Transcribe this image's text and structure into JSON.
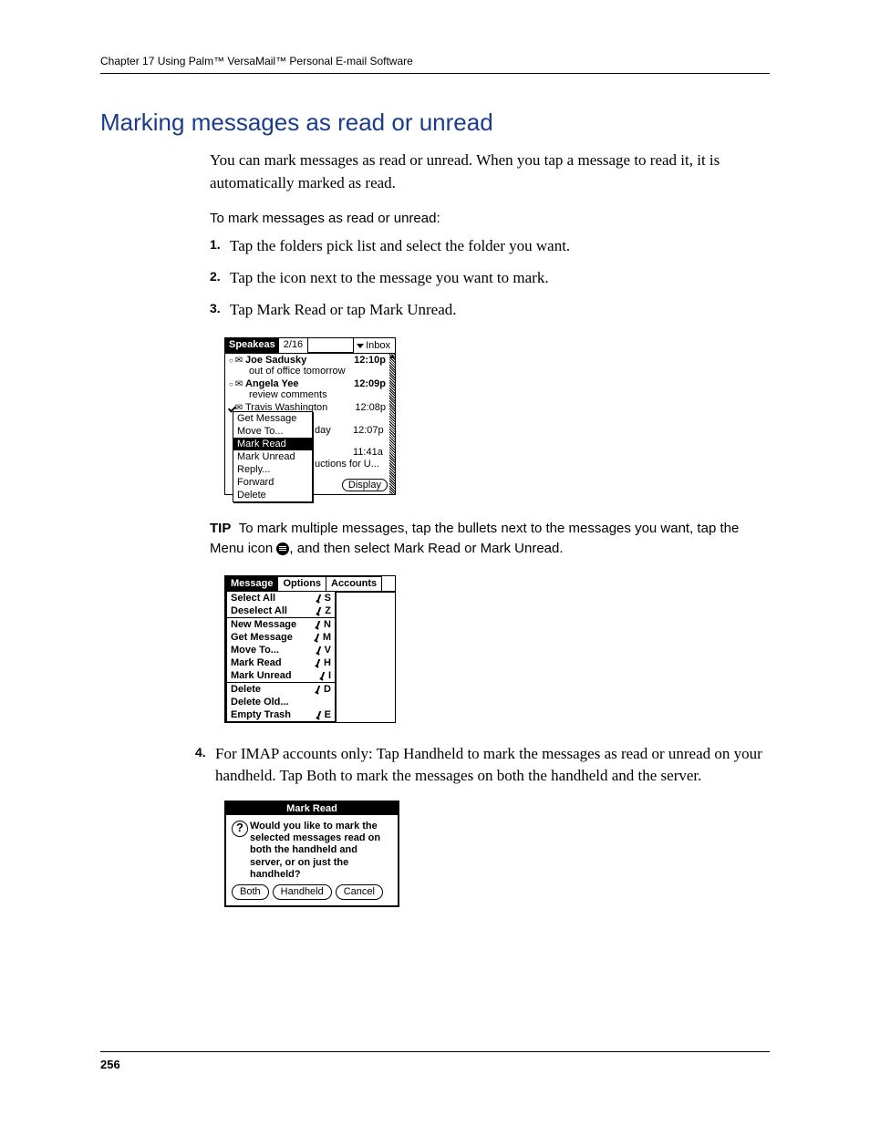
{
  "header": {
    "running": "Chapter 17    Using Palm™ VersaMail™ Personal E-mail Software"
  },
  "section": {
    "title": "Marking messages as read or unread",
    "intro": "You can mark messages as read or unread. When you tap a message to read it, it is automatically marked as read.",
    "procedure_head": "To mark messages as read or unread:",
    "step1": "Tap the folders pick list and select the folder you want.",
    "step2": "Tap the icon next to the message you want to mark.",
    "step3": "Tap Mark Read or tap Mark Unread.",
    "step4": "For IMAP accounts only: Tap Handheld to mark the messages as read or unread on your handheld. Tap Both to mark the messages on both the handheld and the server."
  },
  "tip": {
    "label": "TIP",
    "text_before": "To mark multiple messages, tap the bullets next to the messages you want, tap the Menu icon",
    "text_after": ", and then select Mark Read or Mark Unread."
  },
  "shot1": {
    "account": "Speakeas",
    "date": "2/16",
    "folder": "Inbox",
    "messages": [
      {
        "from": "Joe Sadusky",
        "time": "12:10p",
        "subj": "out of office tomorrow",
        "read": false
      },
      {
        "from": "Angela Yee",
        "time": "12:09p",
        "subj": "review comments",
        "read": false
      },
      {
        "from": "Travis Washington",
        "time": "12:08p",
        "subj": "",
        "read": true,
        "checked": true
      },
      {
        "from": "",
        "time": "12:07p",
        "subj": "day",
        "partial": true
      },
      {
        "from": "",
        "time": "11:41a",
        "subj": "uctions for U...",
        "partial": true
      }
    ],
    "ctx": [
      "Get Message",
      "Move To...",
      "Mark Read",
      "Mark Unread",
      "Reply...",
      "Forward",
      "Delete"
    ],
    "ctx_selected": "Mark Read",
    "display_btn": "Display"
  },
  "shot2": {
    "tabs": [
      "Message",
      "Options",
      "Accounts"
    ],
    "groups": [
      [
        {
          "label": "Select All",
          "sc": "S"
        },
        {
          "label": "Deselect All",
          "sc": "Z"
        }
      ],
      [
        {
          "label": "New Message",
          "sc": "N"
        },
        {
          "label": "Get Message",
          "sc": "M"
        },
        {
          "label": "Move To...",
          "sc": "V"
        },
        {
          "label": "Mark Read",
          "sc": "H"
        },
        {
          "label": "Mark Unread",
          "sc": "I"
        }
      ],
      [
        {
          "label": "Delete",
          "sc": "D"
        },
        {
          "label": "Delete Old...",
          "sc": ""
        },
        {
          "label": "Empty Trash",
          "sc": "E"
        }
      ]
    ]
  },
  "shot3": {
    "title": "Mark Read",
    "body": "Would you like to mark the selected messages read on both the handheld and server, or on just the handheld?",
    "buttons": [
      "Both",
      "Handheld",
      "Cancel"
    ]
  },
  "page_number": "256"
}
